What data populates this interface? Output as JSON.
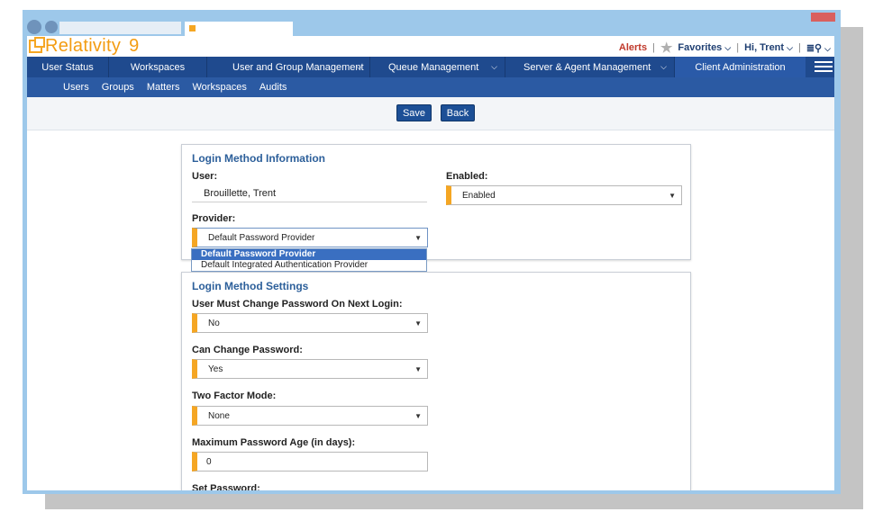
{
  "app": {
    "name": "Relativity",
    "version": "9"
  },
  "header": {
    "alerts": "Alerts",
    "favorites": "Favorites",
    "greeting": "Hi, Trent",
    "search_icon": "search-icon"
  },
  "nav": {
    "items": [
      {
        "label": "User Status",
        "dropdown": false
      },
      {
        "label": "Workspaces",
        "dropdown": false
      },
      {
        "label": "User and Group Management",
        "dropdown": true
      },
      {
        "label": "Queue Management",
        "dropdown": true
      },
      {
        "label": "Server & Agent Management",
        "dropdown": true
      },
      {
        "label": "Client Administration",
        "dropdown": false
      }
    ],
    "subitems": [
      "Users",
      "Groups",
      "Matters",
      "Workspaces",
      "Audits"
    ]
  },
  "toolbar": {
    "save_label": "Save",
    "back_label": "Back"
  },
  "login_info": {
    "title": "Login Method Information",
    "user_label": "User:",
    "user_value": "Brouillette, Trent",
    "enabled_label": "Enabled:",
    "enabled_value": "Enabled",
    "provider_label": "Provider:",
    "provider_value": "Default Password Provider",
    "provider_options": [
      "Default Password Provider",
      "Default Integrated Authentication Provider"
    ]
  },
  "login_settings": {
    "title": "Login Method Settings",
    "must_change_label": "User Must Change Password On Next Login:",
    "must_change_value": "No",
    "can_change_label": "Can Change Password:",
    "can_change_value": "Yes",
    "two_factor_label": "Two Factor Mode:",
    "two_factor_value": "None",
    "max_age_label": "Maximum Password Age (in days):",
    "max_age_value": "0",
    "set_password_label": "Set Password:"
  },
  "colors": {
    "nav": "#1f4a8e",
    "subnav": "#2b5aa3",
    "accent": "#f5a623",
    "title": "#2c5f9a"
  }
}
